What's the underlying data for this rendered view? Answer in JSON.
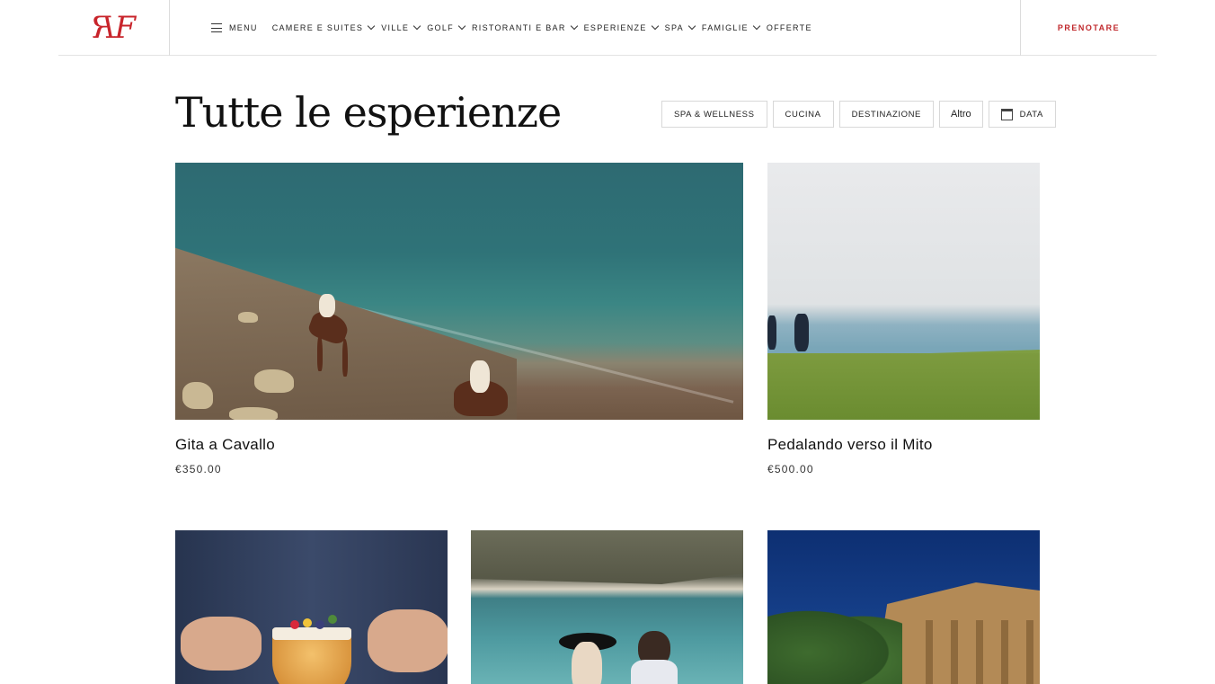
{
  "header": {
    "logo_text": "RF",
    "menu_label": "MENU",
    "nav_items": [
      {
        "label": "CAMERE E SUITES",
        "has_dropdown": true
      },
      {
        "label": "VILLE",
        "has_dropdown": true
      },
      {
        "label": "GOLF",
        "has_dropdown": true
      },
      {
        "label": "RISTORANTI E BAR",
        "has_dropdown": true
      },
      {
        "label": "ESPERIENZE",
        "has_dropdown": true
      },
      {
        "label": "SPA",
        "has_dropdown": true
      },
      {
        "label": "FAMIGLIE",
        "has_dropdown": true
      },
      {
        "label": "OFFERTE",
        "has_dropdown": false
      }
    ],
    "book_label": "PRENOTARE"
  },
  "main": {
    "title": "Tutte le esperienze",
    "filters": [
      {
        "label": "SPA & WELLNESS"
      },
      {
        "label": "CUCINA"
      },
      {
        "label": "DESTINAZIONE"
      },
      {
        "label": "Altro"
      },
      {
        "label": "DATA",
        "icon": "calendar-icon"
      }
    ],
    "cards": [
      {
        "title": "Gita a Cavallo",
        "price": "€350.00",
        "image": "horse-riding-beach"
      },
      {
        "title": "Pedalando verso il Mito",
        "price": "€500.00",
        "image": "cycling-golf-course"
      },
      {
        "title": "",
        "price": "",
        "image": "cocktail"
      },
      {
        "title": "",
        "price": "",
        "image": "beach-couple"
      },
      {
        "title": "",
        "price": "",
        "image": "greek-temple"
      }
    ]
  },
  "colors": {
    "brand_red": "#c8242b",
    "text": "#111111",
    "border": "#d8d8d8"
  }
}
